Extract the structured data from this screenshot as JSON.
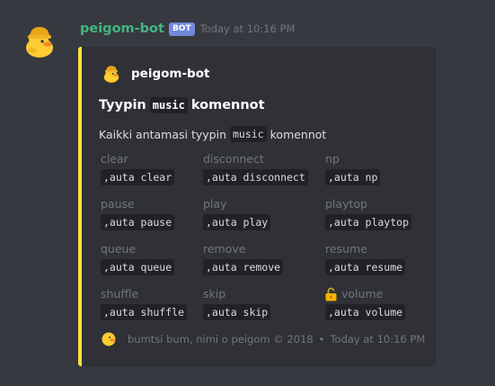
{
  "message": {
    "username": "peigom-bot",
    "bot_tag": "BOT",
    "timestamp": "Today at 10:16 PM",
    "avatar_icon": "duck-avatar-icon"
  },
  "embed": {
    "accent_color": "#ffe23f",
    "author": {
      "name": "peigom-bot",
      "icon": "duck-avatar-icon"
    },
    "title": {
      "prefix": "Tyypin",
      "code": "music",
      "suffix": "komennot"
    },
    "description": {
      "prefix": "Kaikki antamasi tyypin",
      "code": "music",
      "suffix": "komennot"
    },
    "fields": [
      {
        "name": "clear",
        "value": ",auta clear"
      },
      {
        "name": "disconnect",
        "value": ",auta disconnect"
      },
      {
        "name": "np",
        "value": ",auta np"
      },
      {
        "name": "pause",
        "value": ",auta pause"
      },
      {
        "name": "play",
        "value": ",auta play"
      },
      {
        "name": "playtop",
        "value": ",auta playtop"
      },
      {
        "name": "queue",
        "value": ",auta queue"
      },
      {
        "name": "remove",
        "value": ",auta remove"
      },
      {
        "name": "resume",
        "value": ",auta resume"
      },
      {
        "name": "shuffle",
        "value": ",auta shuffle"
      },
      {
        "name": "skip",
        "value": ",auta skip"
      },
      {
        "name": "volume",
        "value": ",auta volume",
        "icon": "open-lock-icon"
      }
    ],
    "footer": {
      "text": "bumtsi bum, nimi o peigom © 2018",
      "separator": "•",
      "timestamp": "Today at 10:16 PM",
      "icon": "duck-footer-icon"
    }
  }
}
